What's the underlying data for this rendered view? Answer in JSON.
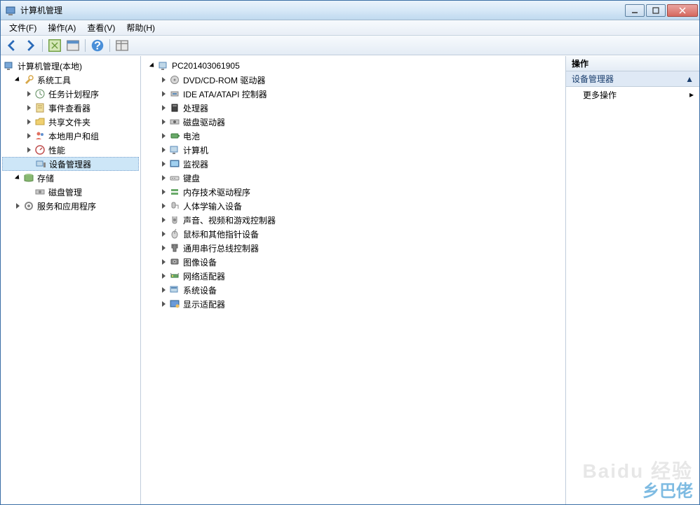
{
  "window": {
    "title": "计算机管理"
  },
  "menu": {
    "file": "文件(F)",
    "action": "操作(A)",
    "view": "查看(V)",
    "help": "帮助(H)"
  },
  "left_tree": {
    "root": "计算机管理(本地)",
    "system_tools": "系统工具",
    "task_scheduler": "任务计划程序",
    "event_viewer": "事件查看器",
    "shared_folders": "共享文件夹",
    "local_users": "本地用户和组",
    "performance": "性能",
    "device_manager": "设备管理器",
    "storage": "存储",
    "disk_management": "磁盘管理",
    "services_apps": "服务和应用程序"
  },
  "device_tree": {
    "computer": "PC201403061905",
    "items": [
      "DVD/CD-ROM 驱动器",
      "IDE ATA/ATAPI 控制器",
      "处理器",
      "磁盘驱动器",
      "电池",
      "计算机",
      "监视器",
      "键盘",
      "内存技术驱动程序",
      "人体学输入设备",
      "声音、视频和游戏控制器",
      "鼠标和其他指针设备",
      "通用串行总线控制器",
      "图像设备",
      "网络适配器",
      "系统设备",
      "显示适配器"
    ]
  },
  "actions": {
    "header": "操作",
    "section": "设备管理器",
    "more": "更多操作"
  }
}
